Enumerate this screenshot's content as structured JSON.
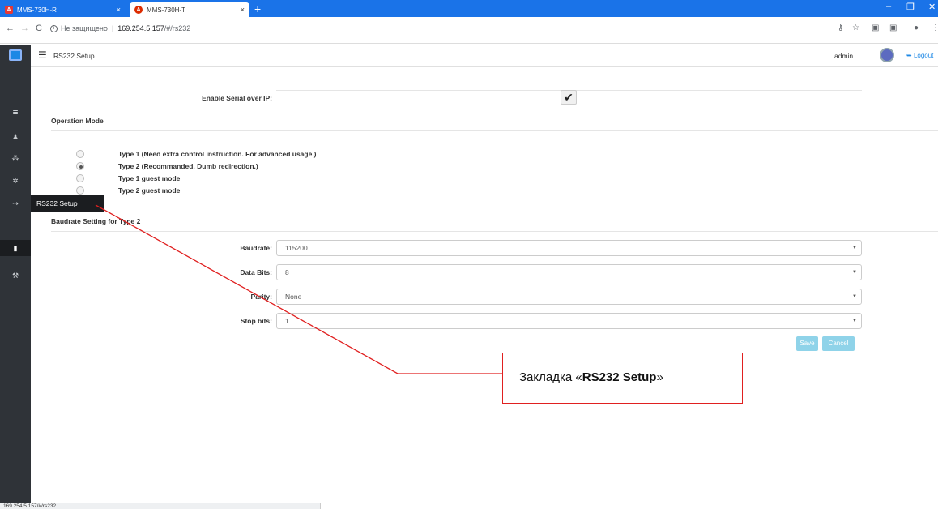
{
  "browser": {
    "tabs": [
      {
        "title": "MMS-730H-R",
        "favicon": "A"
      },
      {
        "title": "MMS-730H-T",
        "favicon": "A"
      }
    ],
    "new_tab": "+",
    "close_glyph": "×",
    "security_label": "Не защищено",
    "url_host": "169.254.5.157",
    "url_path": "/#/rs232",
    "status_url": "169.254.5.157/#/rs232"
  },
  "header": {
    "page_title": "RS232 Setup",
    "user": "admin",
    "logout": "Logout"
  },
  "sidebar": {
    "items": [
      "list-icon",
      "user-icon",
      "network-icon",
      "gear-icon",
      "usb-icon",
      "serial-icon",
      "wrench-icon"
    ],
    "active_flyout": "RS232 Setup"
  },
  "form": {
    "enable_label": "Enable Serial over IP:",
    "enable_checked": true,
    "operation_mode_title": "Operation Mode",
    "modes": [
      {
        "label": "Type 1 (Need extra control instruction. For advanced usage.)",
        "selected": false
      },
      {
        "label": "Type 2 (Recommanded. Dumb redirection.)",
        "selected": true
      },
      {
        "label": "Type 1 guest mode",
        "selected": false
      },
      {
        "label": "Type 2 guest mode",
        "selected": false
      }
    ],
    "baud_section_title": "Baudrate Setting for Type 2",
    "fields": [
      {
        "label": "Baudrate:",
        "value": "115200"
      },
      {
        "label": "Data Bits:",
        "value": "8"
      },
      {
        "label": "Parity:",
        "value": "None"
      },
      {
        "label": "Stop bits:",
        "value": "1"
      }
    ],
    "save": "Save",
    "cancel": "Cancel"
  },
  "annotation": {
    "prefix": "Закладка «",
    "bold": "RS232 Setup",
    "suffix": "»",
    "color": "#e02020"
  }
}
